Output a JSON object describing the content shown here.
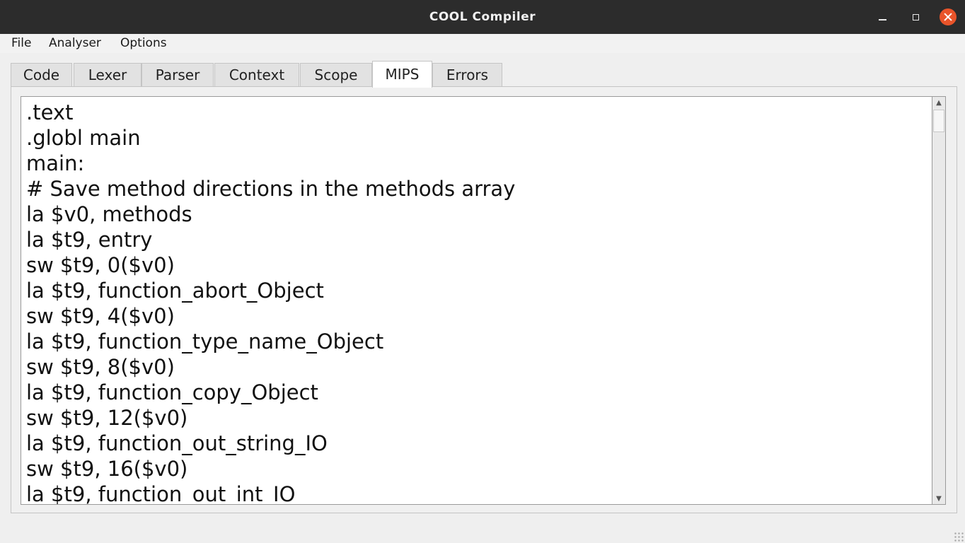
{
  "window": {
    "title": "COOL Compiler",
    "controls": {
      "minimize": "minimize-icon",
      "maximize": "maximize-icon",
      "close": "close-icon"
    },
    "close_color": "#e9542a",
    "titlebar_color": "#2c2c2c"
  },
  "menu": {
    "file": "File",
    "analyser": "Analyser",
    "options": "Options"
  },
  "tabs": [
    {
      "label": "Code"
    },
    {
      "label": "Lexer"
    },
    {
      "label": "Parser"
    },
    {
      "label": "Context"
    },
    {
      "label": "Scope"
    },
    {
      "label": "MIPS"
    },
    {
      "label": "Errors"
    }
  ],
  "active_tab": "MIPS",
  "editor": {
    "lines": [
      ".text",
      ".globl main",
      "main:",
      "# Save method directions in the methods array",
      "la $v0, methods",
      "la $t9, entry",
      "sw $t9, 0($v0)",
      "la $t9, function_abort_Object",
      "sw $t9, 4($v0)",
      "la $t9, function_type_name_Object",
      "sw $t9, 8($v0)",
      "la $t9, function_copy_Object",
      "sw $t9, 12($v0)",
      "la $t9, function_out_string_IO",
      "sw $t9, 16($v0)",
      "la $t9, function_out_int_IO"
    ]
  }
}
